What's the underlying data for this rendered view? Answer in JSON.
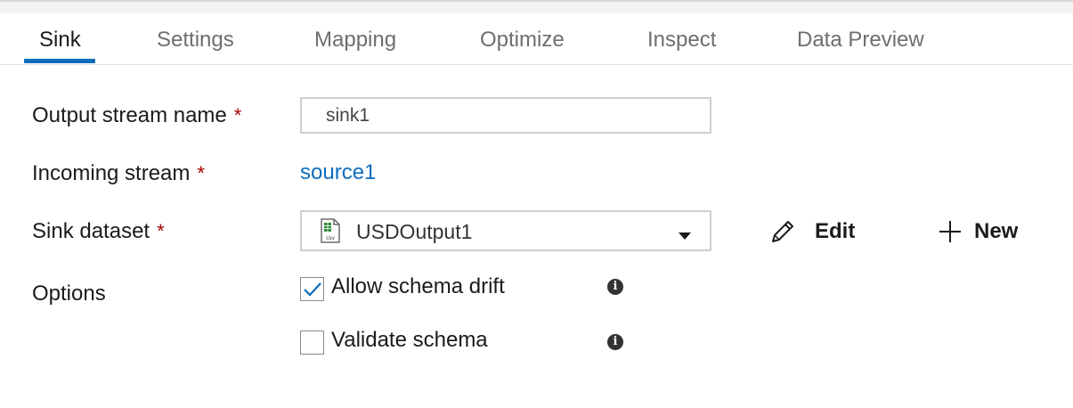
{
  "tabs": [
    {
      "label": "Sink",
      "active": true
    },
    {
      "label": "Settings",
      "active": false
    },
    {
      "label": "Mapping",
      "active": false
    },
    {
      "label": "Optimize",
      "active": false
    },
    {
      "label": "Inspect",
      "active": false
    },
    {
      "label": "Data Preview",
      "active": false
    }
  ],
  "form": {
    "output_stream_name": {
      "label": "Output stream name",
      "required_mark": "*",
      "value": "sink1"
    },
    "incoming_stream": {
      "label": "Incoming stream",
      "required_mark": "*",
      "value": "source1"
    },
    "sink_dataset": {
      "label": "Sink dataset",
      "required_mark": "*",
      "value": "USDOutput1",
      "icon": "csv-file-icon",
      "edit_label": "Edit",
      "new_label": "New"
    },
    "options": {
      "label": "Options",
      "allow_schema_drift": {
        "label": "Allow schema drift",
        "checked": true
      },
      "validate_schema": {
        "label": "Validate schema",
        "checked": false
      }
    }
  },
  "colors": {
    "accent": "#0f6cbd",
    "required": "#a80000",
    "link": "#0f6cbd"
  }
}
